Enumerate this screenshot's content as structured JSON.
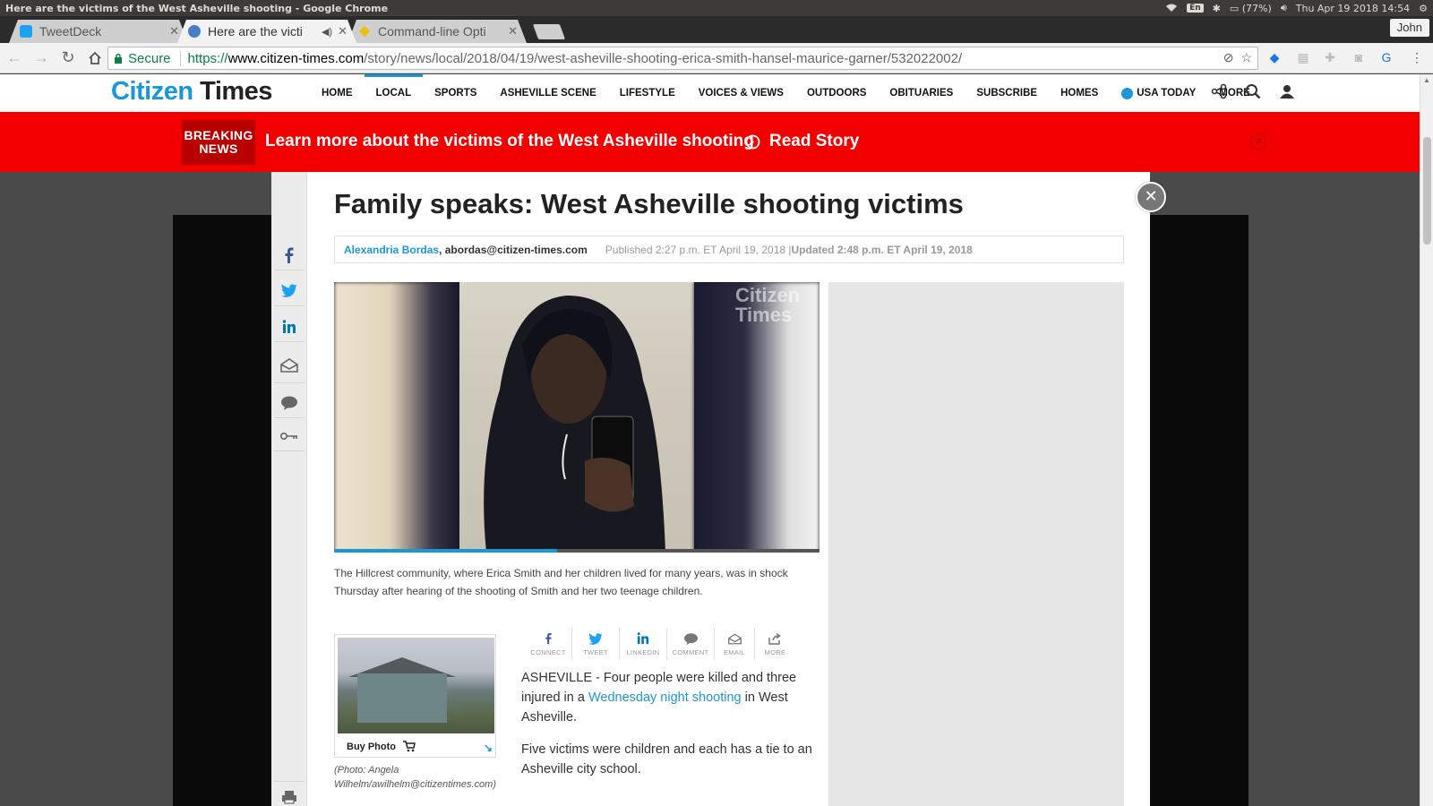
{
  "os": {
    "window_title": "Here are the victims of the West Asheville shooting - Google Chrome",
    "battery": "(77%)",
    "clock": "Thu Apr 19 2018 14:54",
    "lang": "En"
  },
  "browser": {
    "tabs": [
      {
        "label": "TweetDeck"
      },
      {
        "label": "Here are the victi"
      },
      {
        "label": "Command-line Opti"
      }
    ],
    "profile": "John",
    "secure_label": "Secure",
    "url_scheme": "https://",
    "url_host": "www.citizen-times.com",
    "url_path": "/story/news/local/2018/04/19/west-asheville-shooting-erica-smith-hansel-maurice-garner/532022002/"
  },
  "site": {
    "logo_part1": "Citizen",
    "logo_part2": "Times",
    "nav": [
      "HOME",
      "LOCAL",
      "SPORTS",
      "ASHEVILLE SCENE",
      "LIFESTYLE",
      "VOICES & VIEWS",
      "OUTDOORS",
      "OBITUARIES",
      "SUBSCRIBE",
      "HOMES",
      "USA TODAY",
      "MORE"
    ]
  },
  "breaking": {
    "tag": "BREAKING NEWS",
    "tag_line1": "BREAKING",
    "tag_line2": "NEWS",
    "headline": "Learn more about the victims of the West Asheville shooting",
    "read": "Read Story"
  },
  "article": {
    "headline": "Family speaks: West Asheville shooting victims",
    "author": "Alexandria Bordas",
    "email": ", abordas@citizen-times.com",
    "published": "Published 2:27 p.m. ET April 19, 2018 | ",
    "updated": "Updated 2:48 p.m. ET April 19, 2018",
    "photo_watermark": "Citizen Times",
    "video_progress": 0.46,
    "caption": "The Hillcrest community, where Erica Smith and her children lived for many years, was in shock Thursday after hearing of the shooting of Smith and her two teenage children.",
    "buy_photo": "Buy Photo",
    "photo_credit": "(Photo: Angela Wilhelm/awilhelm@citizentimes.com)",
    "tools": [
      "CONNECT",
      "TWEET",
      "LINKEDIN",
      "COMMENT",
      "EMAIL",
      "MORE"
    ],
    "para1_pre": "ASHEVILLE - Four people were killed and three injured in a ",
    "para1_link": "Wednesday night shooting",
    "para1_post": " in West Asheville.",
    "para2": "Five victims were children and each has a tie to an Asheville city school."
  },
  "colors": {
    "brand_blue": "#1a98d5",
    "breaking_red": "#f20000"
  }
}
